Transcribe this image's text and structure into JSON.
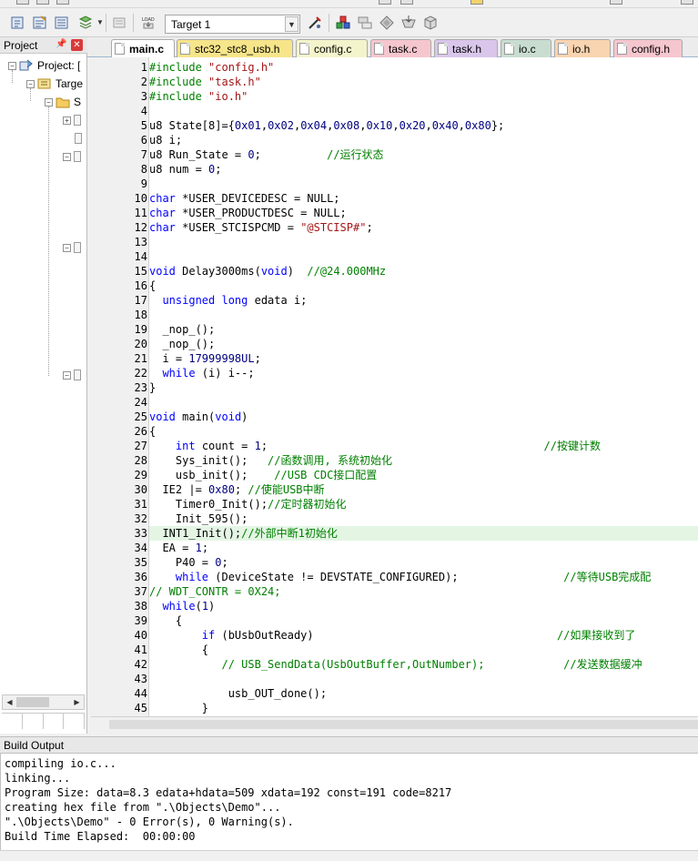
{
  "toolbar": {
    "target": "Target 1"
  },
  "project_panel": {
    "title": "Project",
    "root_label": "Project: [",
    "target_label": "Targe",
    "group_label": "S"
  },
  "tabs": [
    {
      "label": "main.c",
      "color": "#ffffff",
      "active": true
    },
    {
      "label": "stc32_stc8_usb.h",
      "color": "#f7e58a",
      "active": false
    },
    {
      "label": "config.c",
      "color": "#f4f4cc",
      "active": false
    },
    {
      "label": "task.c",
      "color": "#f6c6cf",
      "active": false
    },
    {
      "label": "task.h",
      "color": "#d9c6ea",
      "active": false
    },
    {
      "label": "io.c",
      "color": "#c8ddd0",
      "active": false
    },
    {
      "label": "io.h",
      "color": "#f9d4b0",
      "active": false
    },
    {
      "label": "config.h",
      "color": "#f6c6cf",
      "active": false
    }
  ],
  "code_lines": [
    {
      "n": "1",
      "tokens": [
        [
          "pp",
          "#include "
        ],
        [
          "str",
          "\"config.h\""
        ]
      ]
    },
    {
      "n": "2",
      "tokens": [
        [
          "pp",
          "#include "
        ],
        [
          "str",
          "\"task.h\""
        ]
      ]
    },
    {
      "n": "3",
      "tokens": [
        [
          "pp",
          "#include "
        ],
        [
          "str",
          "\"io.h\""
        ]
      ]
    },
    {
      "n": "4",
      "tokens": []
    },
    {
      "n": "5",
      "tokens": [
        [
          "plain",
          "u8 State[8]={"
        ],
        [
          "num",
          "0x01"
        ],
        [
          "plain",
          ","
        ],
        [
          "num",
          "0x02"
        ],
        [
          "plain",
          ","
        ],
        [
          "num",
          "0x04"
        ],
        [
          "plain",
          ","
        ],
        [
          "num",
          "0x08"
        ],
        [
          "plain",
          ","
        ],
        [
          "num",
          "0x10"
        ],
        [
          "plain",
          ","
        ],
        [
          "num",
          "0x20"
        ],
        [
          "plain",
          ","
        ],
        [
          "num",
          "0x40"
        ],
        [
          "plain",
          ","
        ],
        [
          "num",
          "0x80"
        ],
        [
          "plain",
          "};"
        ]
      ]
    },
    {
      "n": "6",
      "tokens": [
        [
          "plain",
          "u8 i;"
        ]
      ]
    },
    {
      "n": "7",
      "tokens": [
        [
          "plain",
          "u8 Run_State = "
        ],
        [
          "num",
          "0"
        ],
        [
          "plain",
          ";          "
        ],
        [
          "cm",
          "//运行状态"
        ]
      ]
    },
    {
      "n": "8",
      "tokens": [
        [
          "plain",
          "u8 num = "
        ],
        [
          "num",
          "0"
        ],
        [
          "plain",
          ";"
        ]
      ]
    },
    {
      "n": "9",
      "tokens": []
    },
    {
      "n": "10",
      "tokens": [
        [
          "kw",
          "char"
        ],
        [
          "plain",
          " *USER_DEVICEDESC = NULL;"
        ]
      ]
    },
    {
      "n": "11",
      "tokens": [
        [
          "kw",
          "char"
        ],
        [
          "plain",
          " *USER_PRODUCTDESC = NULL;"
        ]
      ]
    },
    {
      "n": "12",
      "tokens": [
        [
          "kw",
          "char"
        ],
        [
          "plain",
          " *USER_STCISPCMD = "
        ],
        [
          "str",
          "\"@STCISP#\""
        ],
        [
          "plain",
          ";"
        ]
      ]
    },
    {
      "n": "13",
      "tokens": []
    },
    {
      "n": "14",
      "tokens": []
    },
    {
      "n": "15",
      "tokens": [
        [
          "kw",
          "void"
        ],
        [
          "plain",
          " Delay3000ms("
        ],
        [
          "kw",
          "void"
        ],
        [
          "plain",
          ")  "
        ],
        [
          "cm",
          "//@24.000MHz"
        ]
      ]
    },
    {
      "n": "16",
      "tokens": [
        [
          "plain",
          "{"
        ]
      ]
    },
    {
      "n": "17",
      "tokens": [
        [
          "plain",
          "  "
        ],
        [
          "kw",
          "unsigned long"
        ],
        [
          "plain",
          " edata i;"
        ]
      ]
    },
    {
      "n": "18",
      "tokens": []
    },
    {
      "n": "19",
      "tokens": [
        [
          "plain",
          "  _nop_();"
        ]
      ]
    },
    {
      "n": "20",
      "tokens": [
        [
          "plain",
          "  _nop_();"
        ]
      ]
    },
    {
      "n": "21",
      "tokens": [
        [
          "plain",
          "  i = "
        ],
        [
          "num",
          "17999998UL"
        ],
        [
          "plain",
          ";"
        ]
      ]
    },
    {
      "n": "22",
      "tokens": [
        [
          "plain",
          "  "
        ],
        [
          "kw",
          "while"
        ],
        [
          "plain",
          " (i) i--;"
        ]
      ]
    },
    {
      "n": "23",
      "tokens": [
        [
          "plain",
          "}"
        ]
      ]
    },
    {
      "n": "24",
      "tokens": []
    },
    {
      "n": "25",
      "tokens": [
        [
          "kw",
          "void"
        ],
        [
          "plain",
          " main("
        ],
        [
          "kw",
          "void"
        ],
        [
          "plain",
          ")"
        ]
      ]
    },
    {
      "n": "26",
      "tokens": [
        [
          "plain",
          "{"
        ]
      ]
    },
    {
      "n": "27",
      "tokens": [
        [
          "plain",
          "    "
        ],
        [
          "kw",
          "int"
        ],
        [
          "plain",
          " count = "
        ],
        [
          "num",
          "1"
        ],
        [
          "plain",
          ";                                          "
        ],
        [
          "cm",
          "//按键计数"
        ]
      ]
    },
    {
      "n": "28",
      "tokens": [
        [
          "plain",
          "    Sys_init();   "
        ],
        [
          "cm",
          "//函数调用, 系统初始化"
        ]
      ]
    },
    {
      "n": "29",
      "tokens": [
        [
          "plain",
          "    usb_init();    "
        ],
        [
          "cm",
          "//USB CDC接口配置"
        ]
      ]
    },
    {
      "n": "30",
      "tokens": [
        [
          "plain",
          "  IE2 |= "
        ],
        [
          "num",
          "0x80"
        ],
        [
          "plain",
          "; "
        ],
        [
          "cm",
          "//使能USB中断"
        ]
      ]
    },
    {
      "n": "31",
      "tokens": [
        [
          "plain",
          "    Timer0_Init();"
        ],
        [
          "cm",
          "//定时器初始化"
        ]
      ]
    },
    {
      "n": "32",
      "tokens": [
        [
          "plain",
          "    Init_595();"
        ]
      ]
    },
    {
      "n": "33",
      "tokens": [
        [
          "plain",
          "  INT1_Init();"
        ],
        [
          "cm",
          "//外部中断1初始化"
        ]
      ],
      "highlight": true
    },
    {
      "n": "34",
      "tokens": [
        [
          "plain",
          "  EA = "
        ],
        [
          "num",
          "1"
        ],
        [
          "plain",
          ";"
        ]
      ]
    },
    {
      "n": "35",
      "tokens": [
        [
          "plain",
          "    P40 = "
        ],
        [
          "num",
          "0"
        ],
        [
          "plain",
          ";"
        ]
      ]
    },
    {
      "n": "36",
      "tokens": [
        [
          "plain",
          "    "
        ],
        [
          "kw",
          "while"
        ],
        [
          "plain",
          " (DeviceState != DEVSTATE_CONFIGURED);                "
        ],
        [
          "cm",
          "//等待USB完成配"
        ]
      ]
    },
    {
      "n": "37",
      "tokens": [
        [
          "cm",
          "// WDT_CONTR = 0X24;"
        ]
      ]
    },
    {
      "n": "38",
      "tokens": [
        [
          "plain",
          "  "
        ],
        [
          "kw",
          "while"
        ],
        [
          "plain",
          "("
        ],
        [
          "num",
          "1"
        ],
        [
          "plain",
          ")"
        ]
      ]
    },
    {
      "n": "39",
      "tokens": [
        [
          "plain",
          "    {"
        ]
      ]
    },
    {
      "n": "40",
      "tokens": [
        [
          "plain",
          "        "
        ],
        [
          "kw",
          "if"
        ],
        [
          "plain",
          " (bUsbOutReady)                                     "
        ],
        [
          "cm",
          "//如果接收到了"
        ]
      ]
    },
    {
      "n": "41",
      "tokens": [
        [
          "plain",
          "        {"
        ]
      ]
    },
    {
      "n": "42",
      "tokens": [
        [
          "plain",
          "           "
        ],
        [
          "cm",
          "// USB_SendData(UsbOutBuffer,OutNumber);            //发送数据缓冲"
        ]
      ]
    },
    {
      "n": "43",
      "tokens": []
    },
    {
      "n": "44",
      "tokens": [
        [
          "plain",
          "            usb_OUT_done();"
        ]
      ]
    },
    {
      "n": "45",
      "tokens": [
        [
          "plain",
          "        }"
        ]
      ]
    }
  ],
  "build_output": {
    "title": "Build Output",
    "lines": [
      "compiling io.c...",
      "linking...",
      "Program Size: data=8.3 edata+hdata=509 xdata=192 const=191 code=8217",
      "creating hex file from \".\\Objects\\Demo\"...",
      "\".\\Objects\\Demo\" - 0 Error(s), 0 Warning(s).",
      "Build Time Elapsed:  00:00:00"
    ]
  },
  "colors": {
    "keyword": "#0000ff",
    "preprocessor": "#008000",
    "string": "#a31515",
    "number": "#000080",
    "comment": "#008000",
    "current_line": "#e4f5e4"
  }
}
